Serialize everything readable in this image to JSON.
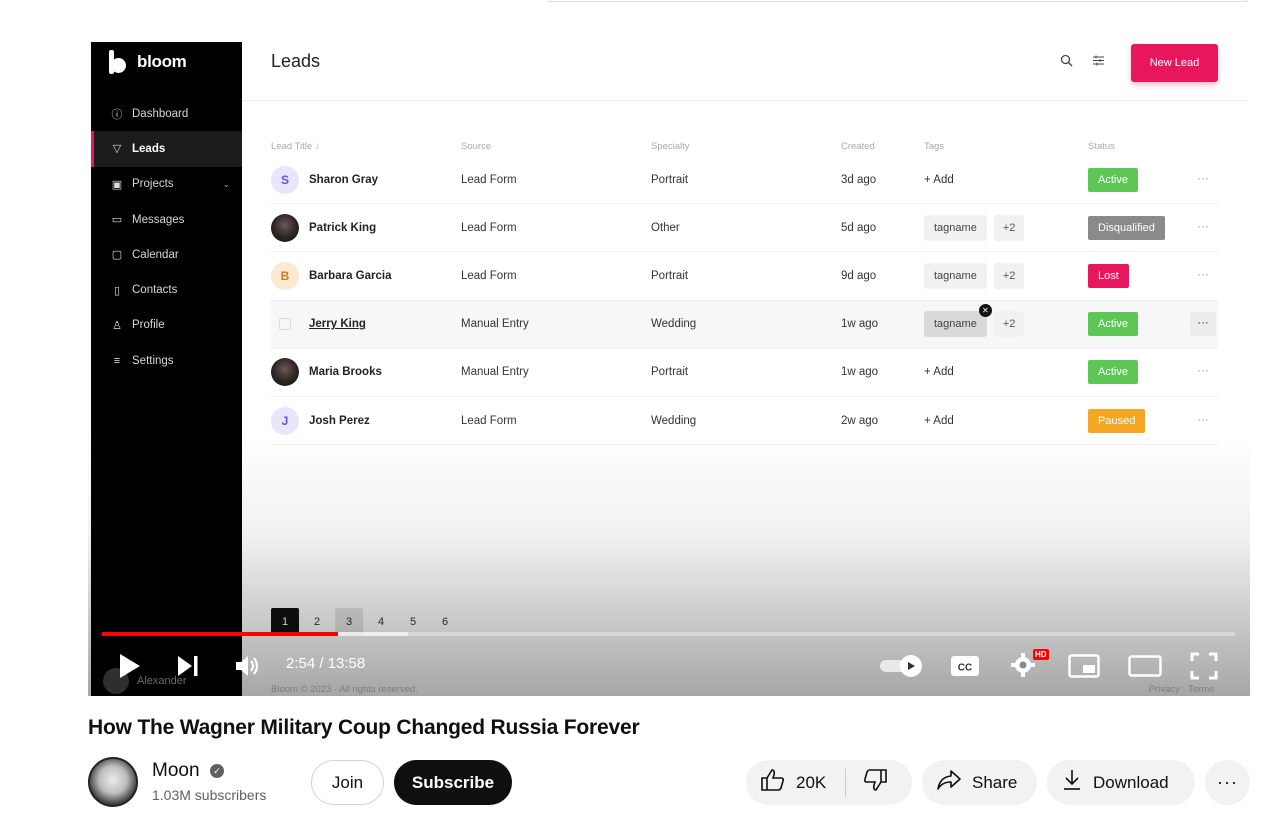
{
  "video": {
    "title": "How The Wagner Military Coup Changed Russia Forever",
    "time_display": "2:54 / 13:58",
    "progress_fraction": 0.208,
    "buffered_fraction": 0.27,
    "hd_badge": "HD"
  },
  "channel": {
    "name": "Moon",
    "subscribers": "1.03M subscribers",
    "join_label": "Join",
    "subscribe_label": "Subscribe"
  },
  "actions": {
    "likes": "20K",
    "share_label": "Share",
    "download_label": "Download"
  },
  "app": {
    "brand": "bloom",
    "page_title": "Leads",
    "new_button": "New Lead",
    "sidebar": [
      {
        "label": "Dashboard",
        "icon": "info-icon"
      },
      {
        "label": "Leads",
        "icon": "filter-icon",
        "active": true
      },
      {
        "label": "Projects",
        "icon": "briefcase-icon",
        "has_chevron": true
      },
      {
        "label": "Messages",
        "icon": "chat-icon"
      },
      {
        "label": "Calendar",
        "icon": "calendar-icon"
      },
      {
        "label": "Contacts",
        "icon": "book-icon"
      },
      {
        "label": "Profile",
        "icon": "person-icon"
      },
      {
        "label": "Settings",
        "icon": "sliders-icon"
      }
    ],
    "user_name": "Alexander",
    "columns": [
      "Lead Title ↓",
      "Source",
      "Specialty",
      "Created",
      "Tags",
      "Status"
    ],
    "rows": [
      {
        "initial": "S",
        "name": "Sharon Gray",
        "source": "Lead Form",
        "specialty": "Portrait",
        "created": "3d ago",
        "tag": "",
        "extra": "",
        "add": "+ Add",
        "status": "Active"
      },
      {
        "initial": "",
        "name": "Patrick King",
        "source": "Lead Form",
        "specialty": "Other",
        "created": "5d ago",
        "tag": "tagname",
        "extra": "+2",
        "add": "",
        "status": "Disqualified"
      },
      {
        "initial": "B",
        "name": "Barbara Garcia",
        "source": "Lead Form",
        "specialty": "Portrait",
        "created": "9d ago",
        "tag": "tagname",
        "extra": "+2",
        "add": "",
        "status": "Lost"
      },
      {
        "initial": "",
        "name": "Jerry King",
        "source": "Manual Entry",
        "specialty": "Wedding",
        "created": "1w ago",
        "tag": "tagname",
        "extra": "+2",
        "add": "",
        "status": "Active"
      },
      {
        "initial": "",
        "name": "Maria Brooks",
        "source": "Manual Entry",
        "specialty": "Portrait",
        "created": "1w ago",
        "tag": "",
        "extra": "",
        "add": "+ Add",
        "status": "Active"
      },
      {
        "initial": "J",
        "name": "Josh Perez",
        "source": "Lead Form",
        "specialty": "Wedding",
        "created": "2w ago",
        "tag": "",
        "extra": "",
        "add": "+ Add",
        "status": "Paused"
      }
    ],
    "row_menu": "···",
    "pages": [
      "1",
      "2",
      "3",
      "4",
      "5",
      "6"
    ],
    "footer_left": "Bloom © 2023  ·  All rights reserved.",
    "footer_right": "Privacy  ·  Terms"
  },
  "colors": {
    "accent": "#e8175d",
    "active": "#5dc654",
    "disqualified": "#8a8a8a",
    "paused": "#f5a623",
    "progress": "#ff0000"
  }
}
